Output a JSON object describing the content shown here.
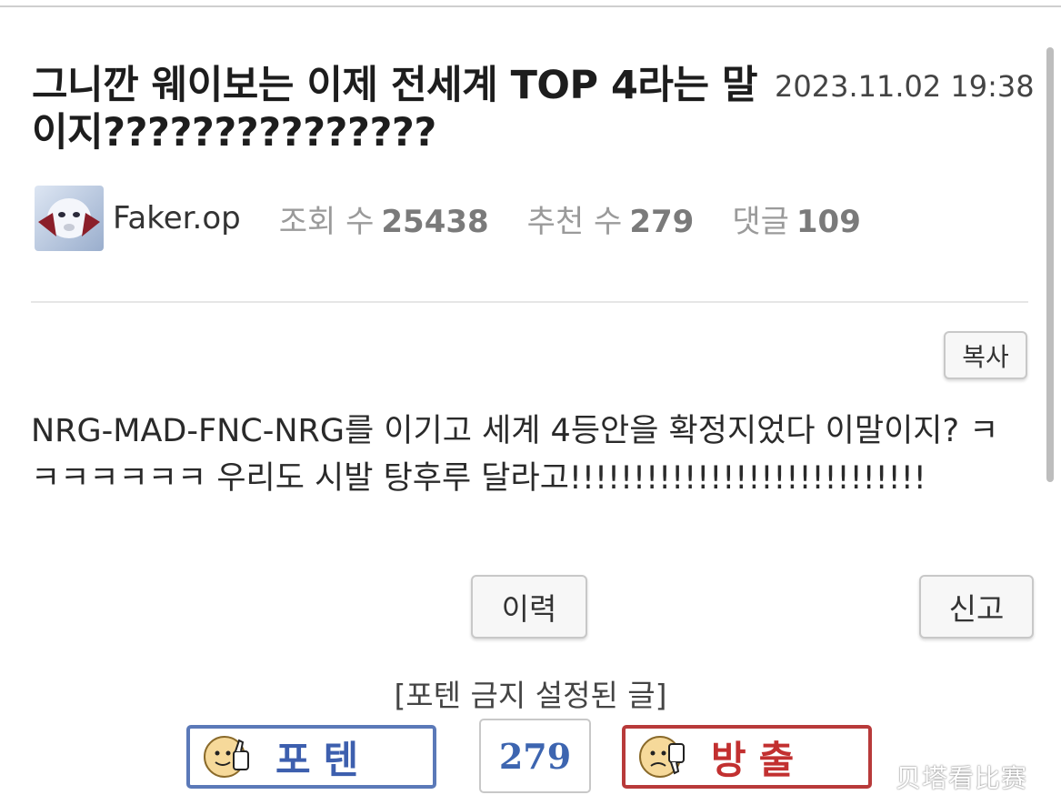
{
  "post": {
    "title": "그니깐 웨이보는 이제 전세계 TOP 4라는 말이지???????????????",
    "date": "2023.11.02 19:38",
    "author": "Faker.op",
    "stats": {
      "views_label": "조회 수",
      "views": "25438",
      "likes_label": "추천 수",
      "likes": "279",
      "comments_label": "댓글",
      "comments": "109"
    },
    "body": "NRG-MAD-FNC-NRG를 이기고 세계 4등안을 확정지었다 이말이지? ㅋㅋㅋㅋㅋㅋㅋ 우리도 시발 탕후루 달라고!!!!!!!!!!!!!!!!!!!!!!!!!!!!"
  },
  "buttons": {
    "copy": "복사",
    "history": "이력",
    "report": "신고"
  },
  "votes": {
    "notice": "[포텐 금지 설정된 글]",
    "up_label": "포텐",
    "count": "279",
    "down_label": "방출",
    "up_color": "#3d5fae",
    "down_color": "#c23030"
  },
  "watermark": "贝塔看比赛"
}
